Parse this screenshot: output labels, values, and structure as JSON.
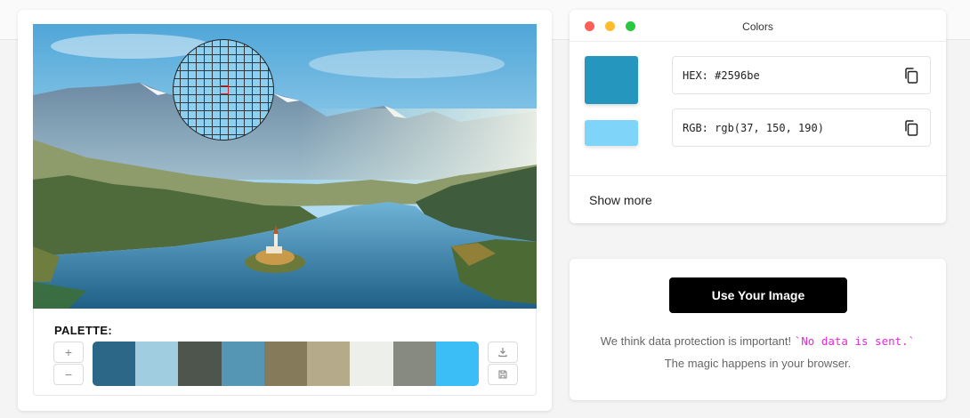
{
  "palette": {
    "title": "PALETTE:",
    "plus_label": "+",
    "minus_label": "−",
    "download_icon": "download-icon",
    "save_icon": "save-icon",
    "swatches": [
      "#2c6787",
      "#a0cde0",
      "#4e554c",
      "#5496b3",
      "#857b5b",
      "#b5aa8a",
      "#edefea",
      "#878a80",
      "#3bbdf6"
    ]
  },
  "colors_window": {
    "title": "Colors",
    "dots": [
      "#fe5f57",
      "#febc2e",
      "#28c840"
    ],
    "primary_color": "#2596be",
    "secondary_color": "#7fd4f9",
    "hex_value": "HEX: #2596be",
    "rgb_value": "RGB: rgb(37, 150, 190)",
    "copy_icon": "copy-icon",
    "show_more": "Show more"
  },
  "upload": {
    "button_label": "Use Your Image",
    "text_before": "We think data protection is important! ",
    "code_text": "`No data is sent.`",
    "text_after": " The magic happens in your browser."
  }
}
